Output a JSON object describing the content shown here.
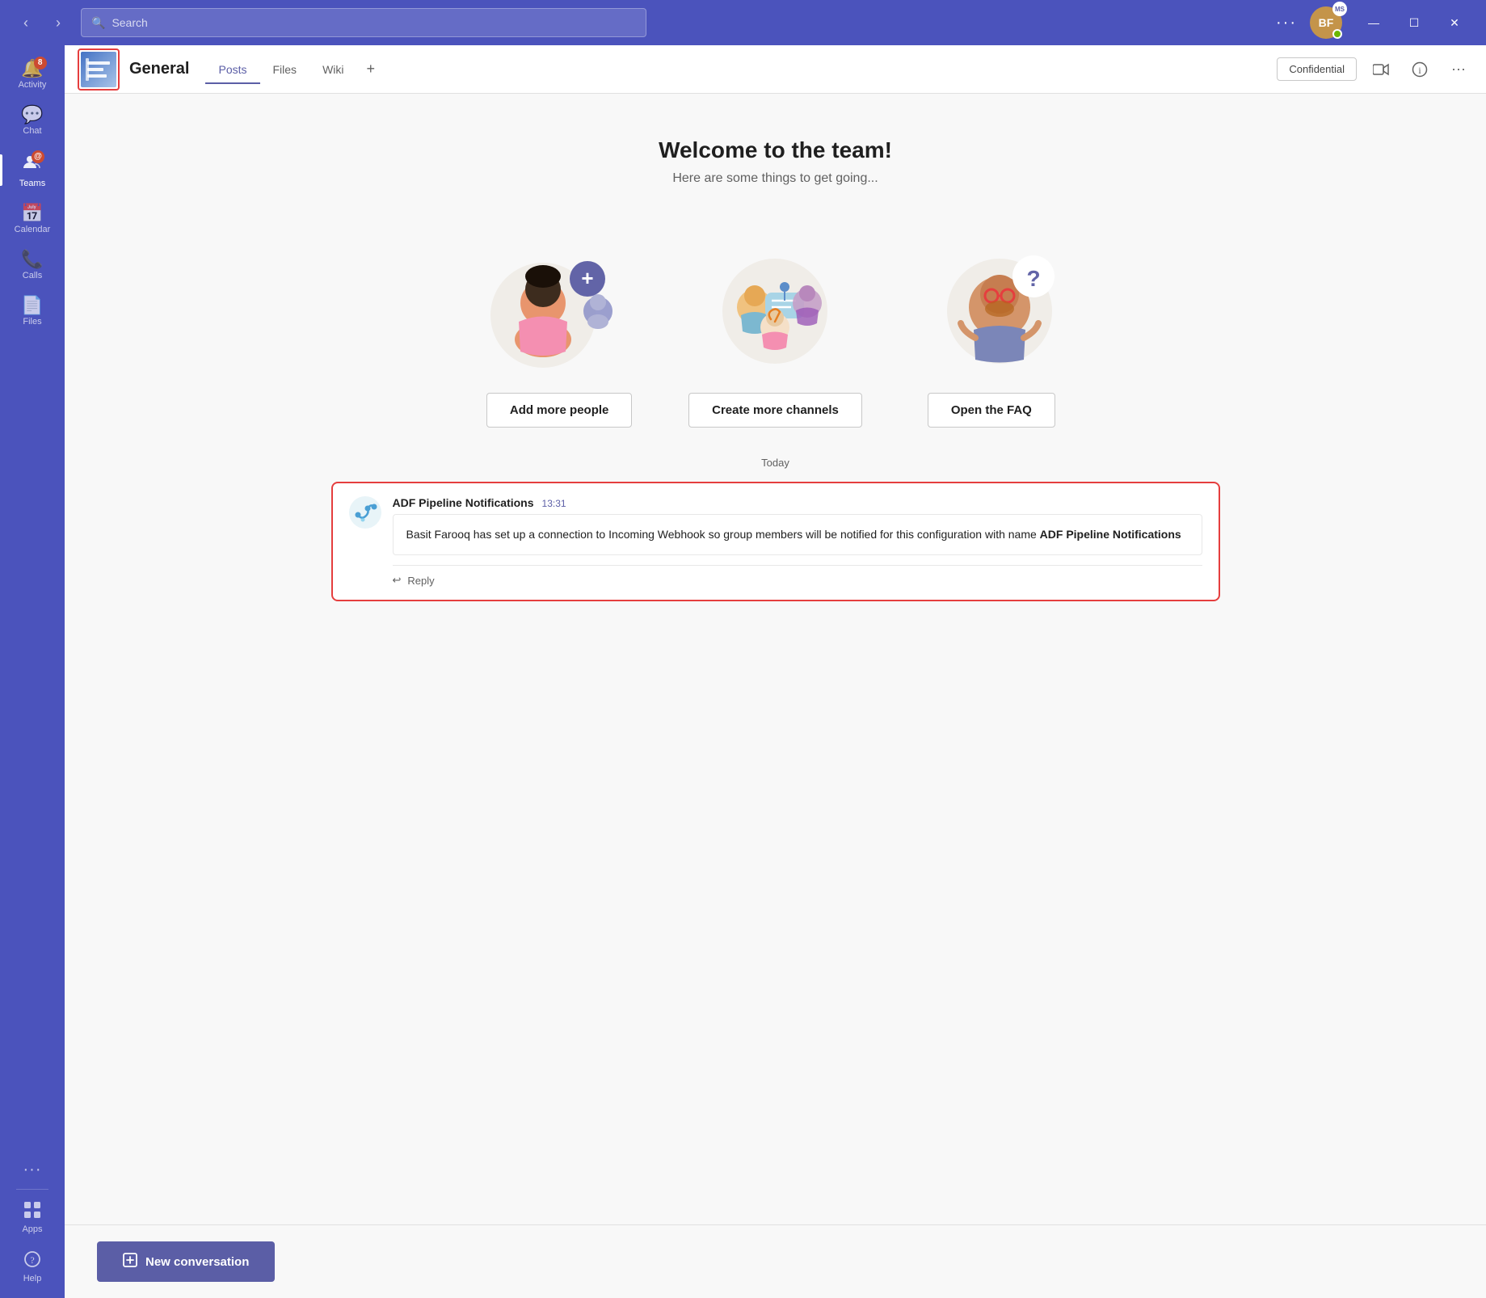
{
  "titlebar": {
    "search_placeholder": "Search",
    "avatar_initials": "BF",
    "ms_badge": "MS",
    "back_arrow": "‹",
    "forward_arrow": "›",
    "more_label": "···",
    "minimize": "—",
    "maximize": "☐",
    "close": "✕"
  },
  "sidebar": {
    "items": [
      {
        "id": "activity",
        "label": "Activity",
        "icon": "🔔",
        "badge": "8",
        "active": false
      },
      {
        "id": "chat",
        "label": "Chat",
        "icon": "💬",
        "badge": null,
        "active": false
      },
      {
        "id": "teams",
        "label": "Teams",
        "icon": "👥",
        "badge": null,
        "active": true
      },
      {
        "id": "calendar",
        "label": "Calendar",
        "icon": "📅",
        "badge": null,
        "active": false
      },
      {
        "id": "calls",
        "label": "Calls",
        "icon": "📞",
        "badge": null,
        "active": false
      },
      {
        "id": "files",
        "label": "Files",
        "icon": "📄",
        "badge": null,
        "active": false
      }
    ],
    "more": "···",
    "apps_label": "Apps",
    "help_label": "Help"
  },
  "channel": {
    "name": "General",
    "tabs": [
      {
        "label": "Posts",
        "active": true
      },
      {
        "label": "Files",
        "active": false
      },
      {
        "label": "Wiki",
        "active": false
      }
    ],
    "tab_plus": "+",
    "confidential_label": "Confidential",
    "video_icon": "📹",
    "info_icon": "ℹ",
    "more_icon": "···"
  },
  "welcome": {
    "title": "Welcome to the team!",
    "subtitle": "Here are some things to get going..."
  },
  "actions": {
    "add_people": "Add more people",
    "create_channels": "Create more channels",
    "open_faq": "Open the FAQ"
  },
  "today": {
    "label": "Today"
  },
  "message": {
    "author": "ADF Pipeline Notifications",
    "time": "13:31",
    "content_plain": "Basit Farooq has set up a connection to Incoming Webhook so group members will be notified for this configuration with name ",
    "content_bold": "ADF Pipeline Notifications",
    "reply_label": "Reply",
    "reply_icon": "↩"
  },
  "compose": {
    "new_conversation_label": "New conversation",
    "icon": "✎"
  }
}
